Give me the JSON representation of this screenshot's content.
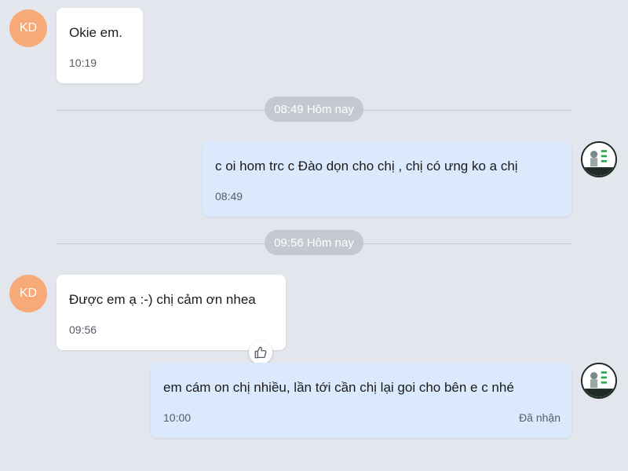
{
  "contact": {
    "initials": "KD"
  },
  "messages": [
    {
      "direction": "in",
      "text": "Okie em.",
      "time": "10:19"
    },
    {
      "direction": "out",
      "text": "c oi hom trc c Đào dọn cho chị , chị có ưng ko a chị",
      "time": "08:49"
    },
    {
      "direction": "in",
      "text": "Được em ạ :-) chị cảm ơn nhea",
      "time": "09:56",
      "reaction_icon": "thumbs-up-icon"
    },
    {
      "direction": "out",
      "text": "em cám on chị nhiều, lần tới cần chị lại goi cho bên e c nhé",
      "time": "10:00",
      "status": "Đã nhận"
    }
  ],
  "dividers": [
    {
      "label": "08:49 Hôm nay"
    },
    {
      "label": "09:56 Hôm nay"
    }
  ],
  "colors": {
    "background": "#e3e6ed",
    "incoming_bubble": "#ffffff",
    "outgoing_bubble": "#dbe9fd",
    "avatar": "#f7a978",
    "divider_pill": "#c4c8d0"
  }
}
